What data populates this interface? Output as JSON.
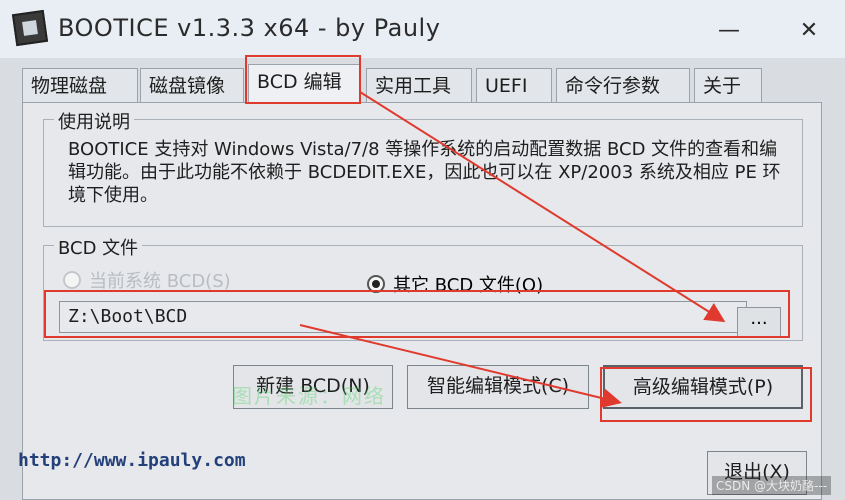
{
  "window": {
    "title": "BOOTICE v1.3.3 x64 - by Pauly",
    "minimize_label": "—",
    "close_label": "✕"
  },
  "tabs": [
    {
      "label": "物理磁盘"
    },
    {
      "label": "磁盘镜像"
    },
    {
      "label": "BCD 编辑"
    },
    {
      "label": "实用工具"
    },
    {
      "label": "UEFI"
    },
    {
      "label": "命令行参数"
    },
    {
      "label": "关于"
    }
  ],
  "usage": {
    "group_label": "使用说明",
    "text": "BOOTICE 支持对 Windows Vista/7/8 等操作系统的启动配置数据 BCD 文件的查看和编辑功能。由于此功能不依赖于 BCDEDIT.EXE，因此也可以在 XP/2003 系统及相应 PE 环境下使用。"
  },
  "bcd_file": {
    "group_label": "BCD 文件",
    "radio_current": "当前系统 BCD(S)",
    "radio_other": "其它 BCD 文件(O)",
    "path_value": "Z:\\Boot\\BCD",
    "browse_label": "..."
  },
  "buttons": {
    "new_bcd": "新建 BCD(N)",
    "smart_edit": "智能编辑模式(C)",
    "advanced_edit": "高级编辑模式(P)",
    "exit": "退出(X)"
  },
  "footer": {
    "link": "http://www.ipauly.com",
    "csdn_watermark": "CSDN @大块奶酪---"
  },
  "overlay": {
    "watermark_text": "图片来源：网络"
  },
  "colors": {
    "annotation_red": "#e03a2e"
  }
}
